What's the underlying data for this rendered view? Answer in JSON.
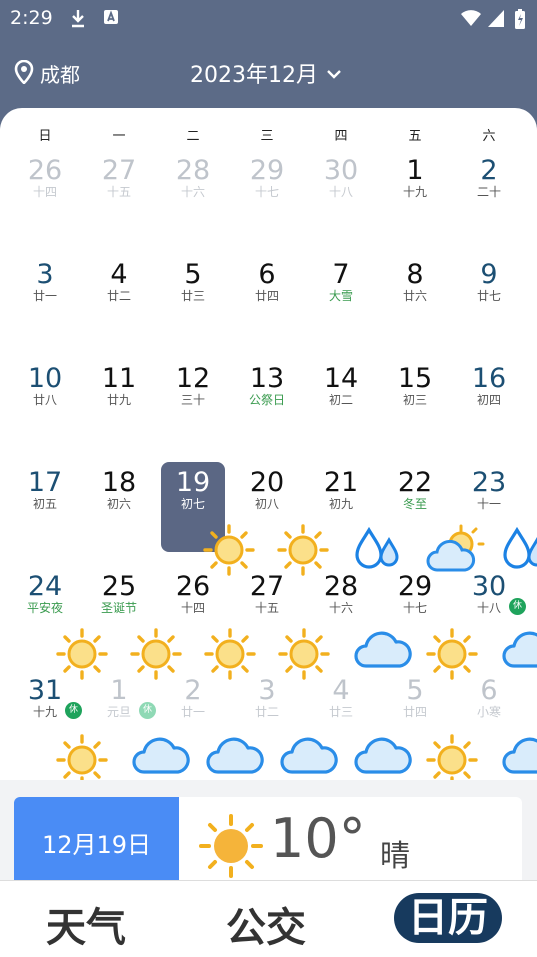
{
  "status_bar": {
    "time": "2:29"
  },
  "header": {
    "location": "成都",
    "month": "2023年12月"
  },
  "weekdays": [
    "日",
    "一",
    "二",
    "三",
    "四",
    "五",
    "六"
  ],
  "calendar": [
    [
      {
        "day": "26",
        "lunar": "十四",
        "faded": true
      },
      {
        "day": "27",
        "lunar": "十五",
        "faded": true
      },
      {
        "day": "28",
        "lunar": "十六",
        "faded": true
      },
      {
        "day": "29",
        "lunar": "十七",
        "faded": true
      },
      {
        "day": "30",
        "lunar": "十八",
        "faded": true
      },
      {
        "day": "1",
        "lunar": "十九"
      },
      {
        "day": "2",
        "lunar": "二十"
      }
    ],
    [
      {
        "day": "3",
        "lunar": "廿一"
      },
      {
        "day": "4",
        "lunar": "廿二"
      },
      {
        "day": "5",
        "lunar": "廿三"
      },
      {
        "day": "6",
        "lunar": "廿四"
      },
      {
        "day": "7",
        "lunar": "大雪",
        "green": true
      },
      {
        "day": "8",
        "lunar": "廿六"
      },
      {
        "day": "9",
        "lunar": "廿七"
      }
    ],
    [
      {
        "day": "10",
        "lunar": "廿八"
      },
      {
        "day": "11",
        "lunar": "廿九"
      },
      {
        "day": "12",
        "lunar": "三十"
      },
      {
        "day": "13",
        "lunar": "公祭日",
        "green": true
      },
      {
        "day": "14",
        "lunar": "初二"
      },
      {
        "day": "15",
        "lunar": "初三"
      },
      {
        "day": "16",
        "lunar": "初四"
      }
    ],
    [
      {
        "day": "17",
        "lunar": "初五"
      },
      {
        "day": "18",
        "lunar": "初六"
      },
      {
        "day": "19",
        "lunar": "初七",
        "selected": true
      },
      {
        "day": "20",
        "lunar": "初八"
      },
      {
        "day": "21",
        "lunar": "初九"
      },
      {
        "day": "22",
        "lunar": "冬至",
        "green": true
      },
      {
        "day": "23",
        "lunar": "十一"
      }
    ],
    [
      {
        "day": "24",
        "lunar": "平安夜",
        "green": true
      },
      {
        "day": "25",
        "lunar": "圣诞节",
        "green": true
      },
      {
        "day": "26",
        "lunar": "十四"
      },
      {
        "day": "27",
        "lunar": "十五"
      },
      {
        "day": "28",
        "lunar": "十六"
      },
      {
        "day": "29",
        "lunar": "十七"
      },
      {
        "day": "30",
        "lunar": "十八",
        "badge": "休"
      }
    ],
    [
      {
        "day": "31",
        "lunar": "十九",
        "badge": "休"
      },
      {
        "day": "1",
        "lunar": "元旦",
        "faded": true,
        "badge": "休"
      },
      {
        "day": "2",
        "lunar": "廿一",
        "faded": true
      },
      {
        "day": "3",
        "lunar": "廿二",
        "faded": true
      },
      {
        "day": "4",
        "lunar": "廿三",
        "faded": true
      },
      {
        "day": "5",
        "lunar": "廿四",
        "faded": true
      },
      {
        "day": "6",
        "lunar": "小寒",
        "faded": true
      }
    ]
  ],
  "weather_icons": {
    "row4": [
      "",
      "",
      "sun",
      "sun",
      "rain",
      "partly-cloudy",
      "rain"
    ],
    "row5": [
      "",
      "sun",
      "sun",
      "sun",
      "sun",
      "cloud",
      "sun",
      "cloud"
    ],
    "row6": [
      "",
      "sun",
      "cloud",
      "cloud",
      "cloud",
      "cloud",
      "sun",
      "cloud"
    ]
  },
  "today": {
    "date": "12月19日",
    "temp": "10°",
    "condition": "晴"
  },
  "tabs": [
    "天气",
    "公交",
    "日历"
  ],
  "colors": {
    "accent": "#4a8cf5",
    "header": "#5c6b87",
    "selected": "#5b6784",
    "active_tab": "#173a5e"
  }
}
